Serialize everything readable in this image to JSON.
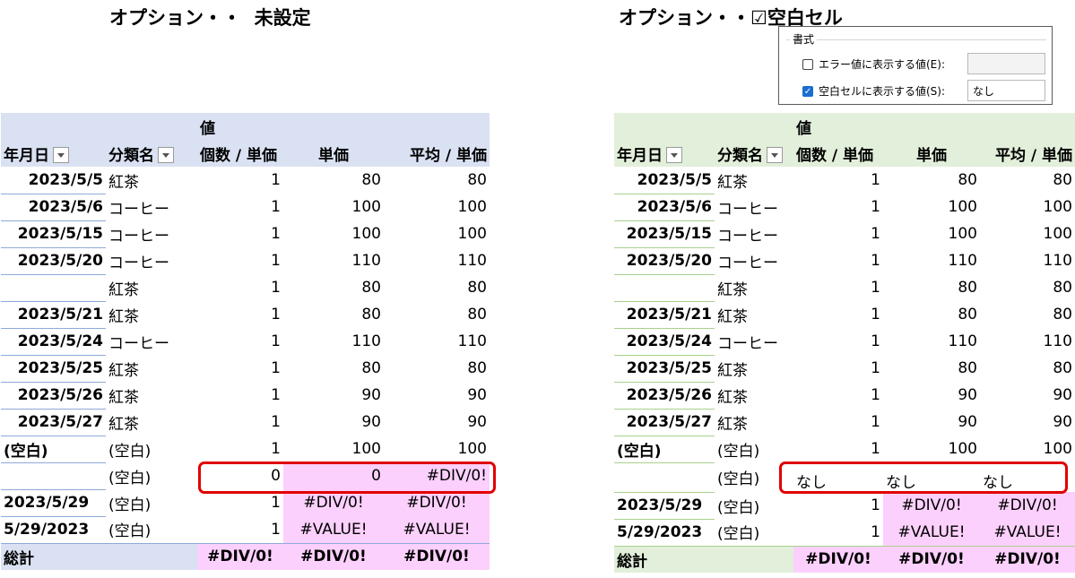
{
  "left_title": "オプション・・  未設定",
  "right_title": "オプション・・☑空白セル",
  "dialog": {
    "caption": "書式",
    "error_label": "エラー値に表示する値(E):",
    "error_checked": false,
    "error_value": "",
    "empty_label": "空白セルに表示する値(S):",
    "empty_checked": true,
    "empty_value": "なし"
  },
  "colors": {
    "left_header": "#d9e1f2",
    "right_header": "#e2efda",
    "left_line": "#8ea9db",
    "right_line": "#a9d08e",
    "highlight": "#fcd0fc",
    "red_box": "#e00000"
  },
  "headers": {
    "values": "値",
    "date": "年月日",
    "category": "分類名",
    "count": "個数 / 単価",
    "price": "単価",
    "avg": "平均 / 単価"
  },
  "left_rows": [
    {
      "date": "2023/5/5",
      "cat": "紅茶",
      "count": "1",
      "price": "80",
      "avg": "80"
    },
    {
      "date": "2023/5/6",
      "cat": "コーヒー",
      "count": "1",
      "price": "100",
      "avg": "100"
    },
    {
      "date": "2023/5/15",
      "cat": "コーヒー",
      "count": "1",
      "price": "100",
      "avg": "100"
    },
    {
      "date": "2023/5/20",
      "cat": "コーヒー",
      "count": "1",
      "price": "110",
      "avg": "110"
    },
    {
      "date": "",
      "cat": "紅茶",
      "count": "1",
      "price": "80",
      "avg": "80"
    },
    {
      "date": "2023/5/21",
      "cat": "紅茶",
      "count": "1",
      "price": "80",
      "avg": "80"
    },
    {
      "date": "2023/5/24",
      "cat": "コーヒー",
      "count": "1",
      "price": "110",
      "avg": "110"
    },
    {
      "date": "2023/5/25",
      "cat": "紅茶",
      "count": "1",
      "price": "80",
      "avg": "80"
    },
    {
      "date": "2023/5/26",
      "cat": "紅茶",
      "count": "1",
      "price": "90",
      "avg": "90"
    },
    {
      "date": "2023/5/27",
      "cat": "紅茶",
      "count": "1",
      "price": "90",
      "avg": "90"
    },
    {
      "date": "(空白)",
      "cat": "(空白)",
      "count": "1",
      "price": "100",
      "avg": "100"
    },
    {
      "date": "",
      "cat": "(空白)",
      "count": "0",
      "price": "0",
      "avg": "#DIV/0!"
    },
    {
      "date": "2023/5/29",
      "cat": "(空白)",
      "count": "1",
      "price": "#DIV/0!",
      "avg": "#DIV/0!"
    },
    {
      "date": "5/29/2023",
      "cat": "(空白)",
      "count": "1",
      "price": "#VALUE!",
      "avg": "#VALUE!"
    }
  ],
  "right_rows": [
    {
      "date": "2023/5/5",
      "cat": "紅茶",
      "count": "1",
      "price": "80",
      "avg": "80"
    },
    {
      "date": "2023/5/6",
      "cat": "コーヒー",
      "count": "1",
      "price": "100",
      "avg": "100"
    },
    {
      "date": "2023/5/15",
      "cat": "コーヒー",
      "count": "1",
      "price": "100",
      "avg": "100"
    },
    {
      "date": "2023/5/20",
      "cat": "コーヒー",
      "count": "1",
      "price": "110",
      "avg": "110"
    },
    {
      "date": "",
      "cat": "紅茶",
      "count": "1",
      "price": "80",
      "avg": "80"
    },
    {
      "date": "2023/5/21",
      "cat": "紅茶",
      "count": "1",
      "price": "80",
      "avg": "80"
    },
    {
      "date": "2023/5/24",
      "cat": "コーヒー",
      "count": "1",
      "price": "110",
      "avg": "110"
    },
    {
      "date": "2023/5/25",
      "cat": "紅茶",
      "count": "1",
      "price": "80",
      "avg": "80"
    },
    {
      "date": "2023/5/26",
      "cat": "紅茶",
      "count": "1",
      "price": "90",
      "avg": "90"
    },
    {
      "date": "2023/5/27",
      "cat": "紅茶",
      "count": "1",
      "price": "90",
      "avg": "90"
    },
    {
      "date": "(空白)",
      "cat": "(空白)",
      "count": "1",
      "price": "100",
      "avg": "100"
    },
    {
      "date": "",
      "cat": "(空白)",
      "count": "なし",
      "price": "なし",
      "avg": "なし"
    },
    {
      "date": "2023/5/29",
      "cat": "(空白)",
      "count": "1",
      "price": "#DIV/0!",
      "avg": "#DIV/0!"
    },
    {
      "date": "5/29/2023",
      "cat": "(空白)",
      "count": "1",
      "price": "#VALUE!",
      "avg": "#VALUE!"
    }
  ],
  "total": {
    "label": "総計",
    "count": "#DIV/0!",
    "price": "#DIV/0!",
    "avg": "#DIV/0!"
  }
}
